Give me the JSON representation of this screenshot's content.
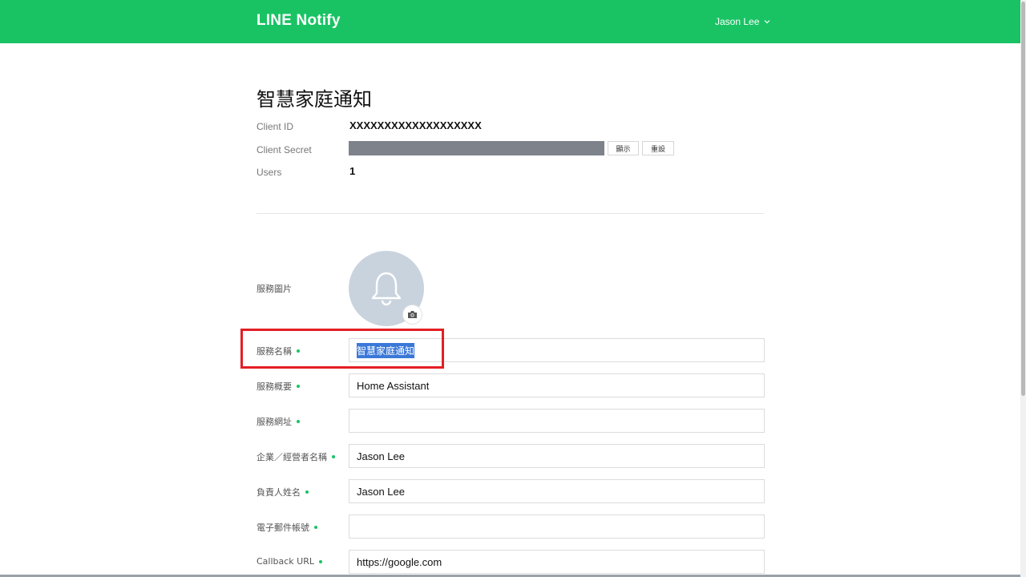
{
  "header": {
    "logo": "LINE Notify",
    "user_name": "Jason Lee",
    "user_menu_icon": "chevron-down-icon",
    "bg_color": "#19c364"
  },
  "service": {
    "title": "智慧家庭通知",
    "client_id_label": "Client ID",
    "client_id_value": "XXXXXXXXXXXXXXXXXXX",
    "client_secret_label": "Client Secret",
    "show_button": "顯示",
    "reset_button": "重設",
    "users_label": "Users",
    "users_value": "1"
  },
  "form": {
    "image_label": "服務圖片",
    "image_icon": "bell-icon",
    "camera_icon": "camera-icon",
    "fields": [
      {
        "label": "服務名稱",
        "value": "智慧家庭通知",
        "selected": true
      },
      {
        "label": "服務概要",
        "value": "Home Assistant"
      },
      {
        "label": "服務網址",
        "value": ""
      },
      {
        "label": "企業／經營者名稱",
        "value": "Jason Lee"
      },
      {
        "label": "負責人姓名",
        "value": "Jason Lee"
      },
      {
        "label": "電子郵件帳號",
        "value": ""
      },
      {
        "label": "Callback URL",
        "value": "https://google.com"
      }
    ]
  },
  "colors": {
    "accent": "#19c364",
    "highlight_box": "#e31e24",
    "selection": "#3a78d8"
  }
}
